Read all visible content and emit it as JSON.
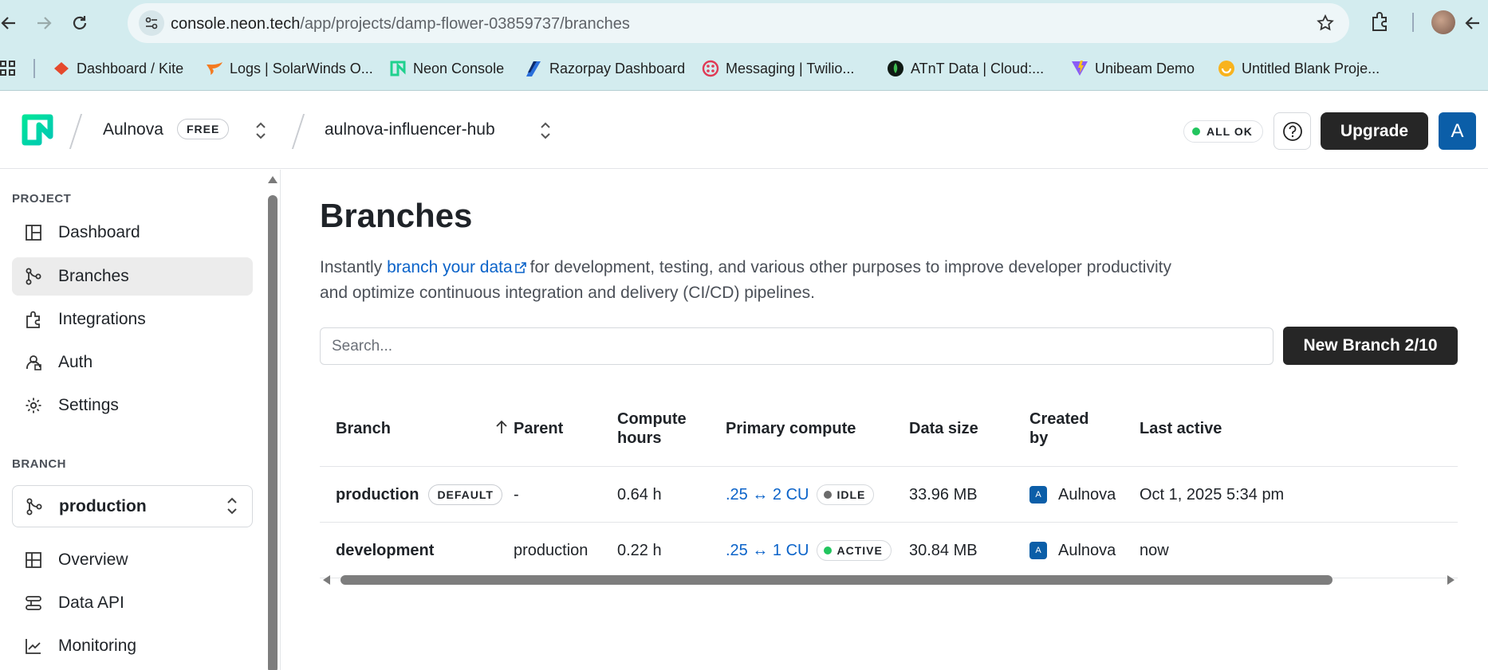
{
  "browser": {
    "url_host": "console.neon.tech",
    "url_path": "/app/projects/damp-flower-03859737/branches",
    "bookmarks": [
      {
        "label": "Dashboard / Kite",
        "icon": "kite-icon"
      },
      {
        "label": "Logs | SolarWinds O...",
        "icon": "solarwinds-icon"
      },
      {
        "label": "Neon Console",
        "icon": "neon-icon"
      },
      {
        "label": "Razorpay Dashboard",
        "icon": "razorpay-icon"
      },
      {
        "label": "Messaging | Twilio...",
        "icon": "twilio-icon"
      },
      {
        "label": "ATnT Data | Cloud:...",
        "icon": "mongodb-icon"
      },
      {
        "label": "Unibeam Demo",
        "icon": "vite-icon"
      },
      {
        "label": "Untitled Blank Proje...",
        "icon": "smiley-icon"
      }
    ]
  },
  "header": {
    "org_name": "Aulnova",
    "plan_badge": "FREE",
    "project_name": "aulnova-influencer-hub",
    "status": "ALL OK",
    "upgrade_label": "Upgrade",
    "avatar_initial": "A",
    "colors": {
      "status_ok": "#22c55e",
      "avatar_bg": "#0b5ea8",
      "brand_green": "#00e599"
    }
  },
  "sidebar": {
    "project_label": "PROJECT",
    "project_items": [
      {
        "label": "Dashboard",
        "icon": "dashboard-icon"
      },
      {
        "label": "Branches",
        "icon": "branch-icon",
        "active": true
      },
      {
        "label": "Integrations",
        "icon": "puzzle-icon"
      },
      {
        "label": "Auth",
        "icon": "auth-icon"
      },
      {
        "label": "Settings",
        "icon": "gear-icon"
      }
    ],
    "branch_label": "BRANCH",
    "branch_selected": "production",
    "branch_items": [
      {
        "label": "Overview",
        "icon": "overview-icon"
      },
      {
        "label": "Data API",
        "icon": "data-api-icon"
      },
      {
        "label": "Monitoring",
        "icon": "monitoring-icon"
      }
    ]
  },
  "main": {
    "title": "Branches",
    "description_prefix": "Instantly",
    "description_link": "branch your data",
    "description_rest_line1": "for development, testing, and various other purposes to improve developer productivity",
    "description_rest_line2": "and optimize continuous integration and delivery (CI/CD) pipelines.",
    "search_placeholder": "Search...",
    "new_branch_label": "New Branch 2/10",
    "table": {
      "columns": [
        "Branch",
        "Parent",
        "Compute hours",
        "Primary compute",
        "Data size",
        "Created by",
        "Last active"
      ],
      "column_lines": {
        "compute_hours": [
          "Compute",
          "hours"
        ],
        "created_by": [
          "Created",
          "by"
        ]
      },
      "rows": [
        {
          "branch": "production",
          "tag": "DEFAULT",
          "parent": "-",
          "compute_hours": "0.64 h",
          "compute": ".25 ↔ 2 CU",
          "state": "IDLE",
          "state_color": "#6b6b6b",
          "data_size": "33.96 MB",
          "created_by_initial": "A",
          "created_by": "Aulnova",
          "last_active": "Oct 1, 2025 5:34 pm"
        },
        {
          "branch": "development",
          "tag": "",
          "parent": "production",
          "compute_hours": "0.22 h",
          "compute": ".25 ↔ 1 CU",
          "state": "ACTIVE",
          "state_color": "#22c55e",
          "data_size": "30.84 MB",
          "created_by_initial": "A",
          "created_by": "Aulnova",
          "last_active": "now"
        }
      ]
    }
  }
}
